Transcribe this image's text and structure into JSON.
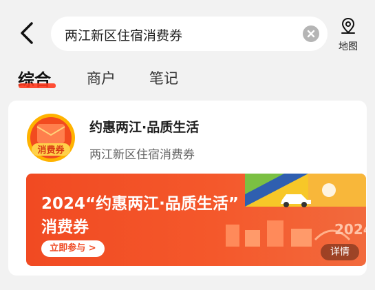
{
  "header": {
    "search_value": "两江新区住宿消费券",
    "map_label": "地图"
  },
  "tabs": [
    {
      "label": "综合",
      "active": true
    },
    {
      "label": "商户",
      "active": false
    },
    {
      "label": "笔记",
      "active": false
    }
  ],
  "result": {
    "title": "约惠两江·品质生活",
    "subtitle": "两江新区住宿消费券",
    "logo_text": "消费券",
    "banner": {
      "title_line1": "2024“约惠两江·品质生活”",
      "title_line2": "消费券",
      "cta_label": "立即参与 >",
      "detail_label": "详情"
    }
  },
  "colors": {
    "accent": "#ff3b1f",
    "banner_orange": "#f14a22"
  }
}
